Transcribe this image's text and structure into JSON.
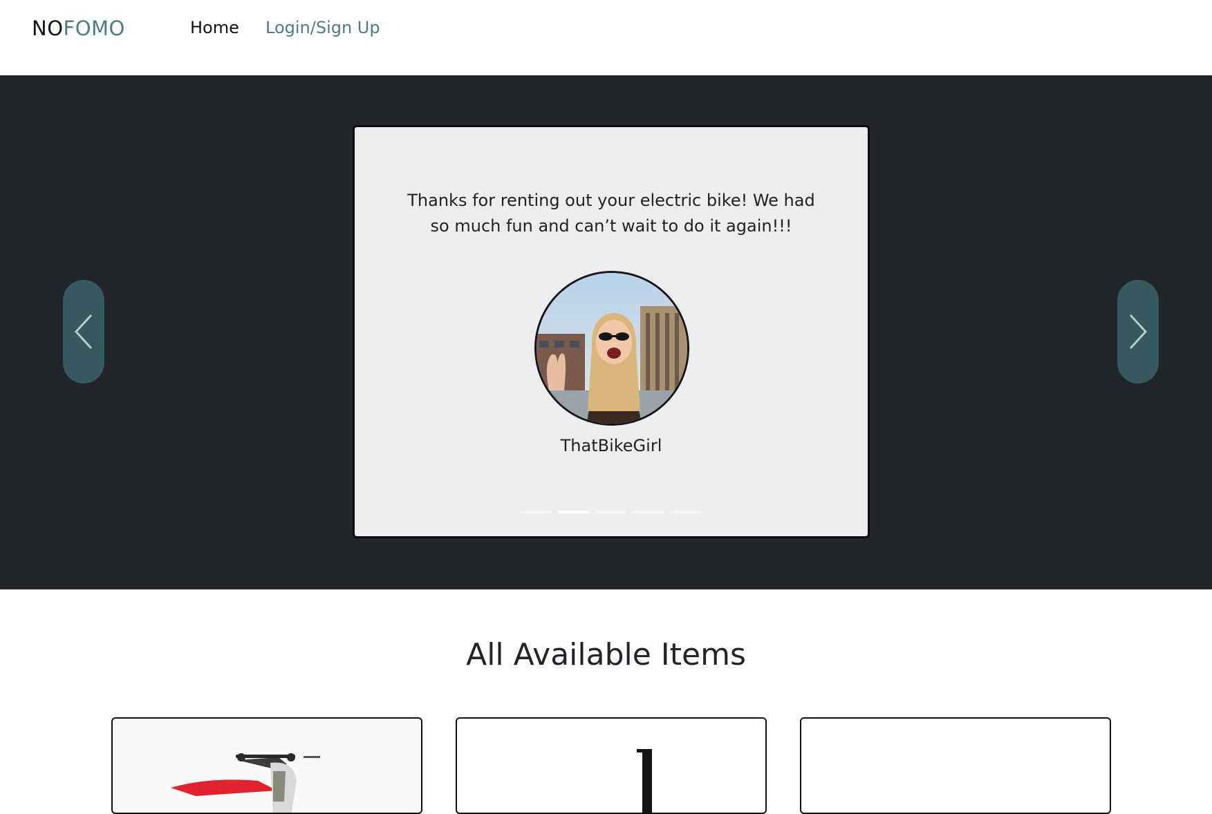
{
  "navbar": {
    "brand_no": "NO",
    "brand_fomo": "FOMO",
    "links": {
      "home": "Home",
      "login": "Login/Sign Up"
    }
  },
  "carousel": {
    "slides_count": 5,
    "active_index": 1,
    "active_slide": {
      "quote": "Thanks for renting out your electric bike! We had so much fun and can’t wait to do it again!!!",
      "username": "ThatBikeGirl",
      "avatar_icon": "user-photo-icon"
    },
    "prev_icon": "chevron-left-icon",
    "next_icon": "chevron-right-icon"
  },
  "items_section": {
    "title": "All Available Items",
    "items": [
      {
        "image_icon": "dirt-bike-icon"
      },
      {
        "image_icon": "scooter-icon"
      },
      {
        "image_icon": "item-image-icon"
      }
    ]
  },
  "colors": {
    "accent": "#4d7c82",
    "hero_bg": "#212529",
    "card_bg": "#ecedef",
    "arrow_bg": "#35595f"
  }
}
